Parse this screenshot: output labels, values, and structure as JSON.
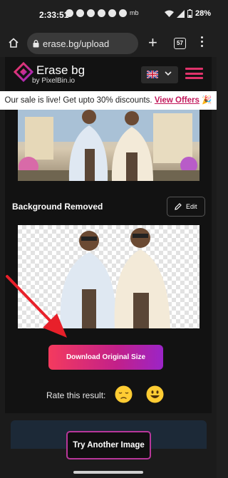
{
  "status_bar": {
    "time": "2:33:51",
    "icon_names": [
      "message-icon",
      "whatsapp-icon",
      "settings-icon",
      "phone-icon",
      "instagram-icon",
      "twitter-icon"
    ],
    "extra": "mb",
    "battery": "28%"
  },
  "browser": {
    "url": "erase.bg/upload",
    "tab_count": "57"
  },
  "header": {
    "logo_title": "Erase bg",
    "logo_subtitle": "by PixelBin.io"
  },
  "promo": {
    "text": "Our sale is live! Get upto 30% discounts.",
    "link": "View Offers",
    "emoji": "🎉"
  },
  "result": {
    "section_title": "Background Removed",
    "edit_label": "Edit",
    "download_label": "Download Original Size",
    "rate_label": "Rate this result:",
    "try_another_label": "Try Another Image"
  },
  "colors": {
    "brand_pink": "#e0336b",
    "download_gradient_start": "#f43a5e",
    "download_gradient_end": "#9b24c7",
    "annotation_arrow": "#e8202a"
  }
}
